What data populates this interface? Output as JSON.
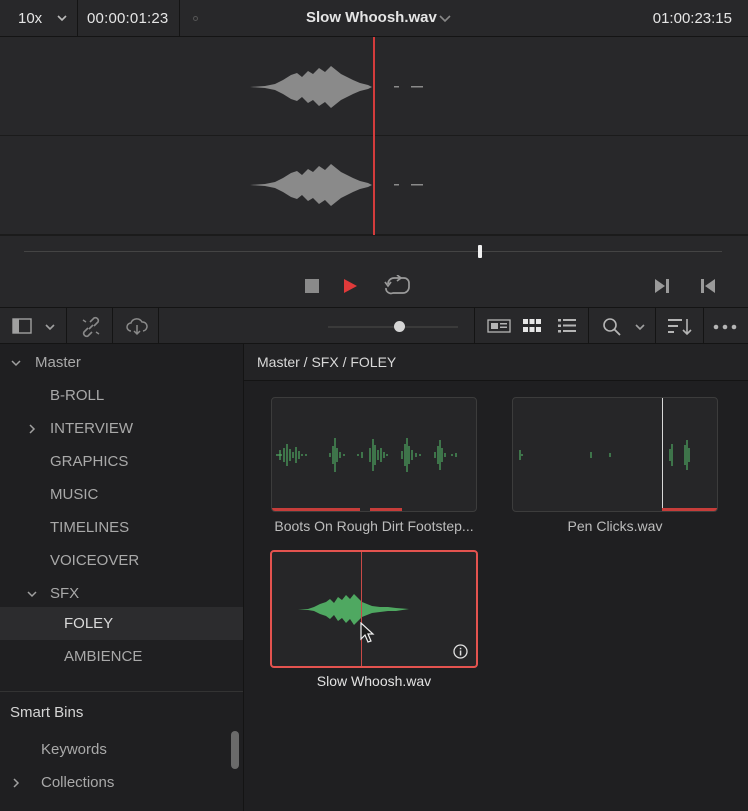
{
  "header": {
    "zoom": "10x",
    "timecode_left": "00:00:01:23",
    "clip_title": "Slow Whoosh.wav",
    "timecode_right": "01:00:23:15"
  },
  "scrubber": {
    "position_fraction": 0.65
  },
  "toolbar": {
    "icons": [
      "sidebar-toggle-icon",
      "chevron-down-icon",
      "unlink-icon",
      "cloud-icon",
      "slider",
      "metadata-view-icon",
      "grid-view-icon",
      "list-view-icon",
      "search-icon",
      "sort-icon",
      "more-icon"
    ]
  },
  "sidebar": {
    "master_label": "Master",
    "bins": [
      {
        "label": "B-ROLL"
      },
      {
        "label": "INTERVIEW"
      },
      {
        "label": "GRAPHICS"
      },
      {
        "label": "MUSIC"
      },
      {
        "label": "TIMELINES"
      },
      {
        "label": "VOICEOVER"
      },
      {
        "label": "SFX"
      },
      {
        "label": "FOLEY"
      },
      {
        "label": "AMBIENCE"
      }
    ],
    "smart_bins_title": "Smart Bins",
    "smart_bins": [
      {
        "label": "Keywords"
      },
      {
        "label": "Collections"
      }
    ]
  },
  "content": {
    "path": "Master / SFX / FOLEY",
    "clips": [
      {
        "name": "Boots On Rough Dirt Footstep..."
      },
      {
        "name": "Pen Clicks.wav"
      },
      {
        "name": "Slow Whoosh.wav"
      }
    ]
  },
  "colors": {
    "accent_red": "#d43c3c",
    "waveform_green": "#4fa861",
    "waveform_gray": "#8a8a8a"
  }
}
